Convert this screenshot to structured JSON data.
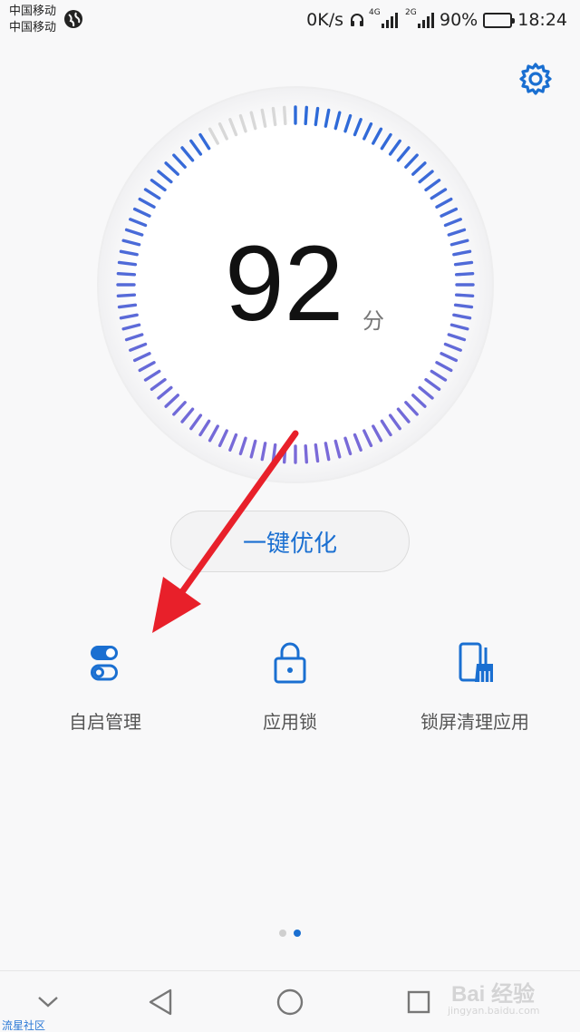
{
  "status_bar": {
    "carrier_1": "中国移动",
    "carrier_2": "中国移动",
    "net_speed": "0K/s",
    "signal_1_tag": "4G",
    "signal_2_tag": "2G",
    "battery_level": "90%",
    "battery_fraction": 0.9,
    "time": "18:24"
  },
  "gauge": {
    "score": "92",
    "unit": "分",
    "score_fraction": 0.92
  },
  "optimize_button": {
    "label": "一键优化"
  },
  "features": [
    {
      "label": "自启管理",
      "icon": "toggle-switch-icon"
    },
    {
      "label": "应用锁",
      "icon": "padlock-icon"
    },
    {
      "label": "锁屏清理应用",
      "icon": "phone-broom-icon"
    }
  ],
  "pagination": {
    "current_page": 2,
    "total_pages": 2
  },
  "watermark": {
    "left_text": "流星社区",
    "logo": "Bai 经验",
    "url": "jingyan.baidu.com"
  },
  "colors": {
    "accent": "#1a6fd1",
    "gauge_active_top": "#2d6ad8",
    "gauge_active_bottom": "#7a6ad8",
    "gauge_inactive": "#d8d8d8",
    "arrow": "#e8202a"
  }
}
